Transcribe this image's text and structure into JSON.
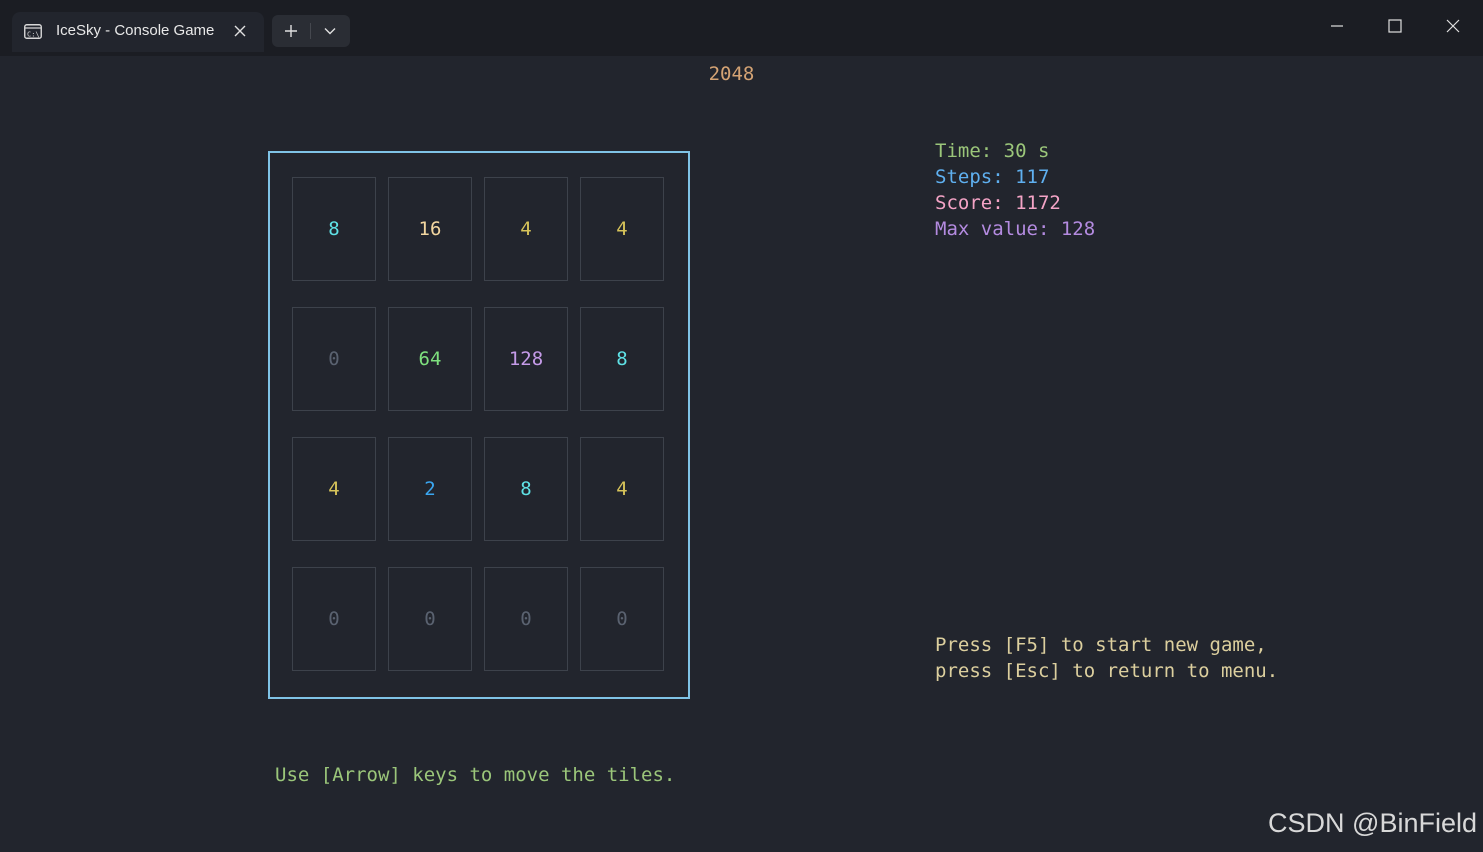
{
  "window": {
    "tab_title": "IceSky - Console Game",
    "icons": {
      "tab": "terminal-icon",
      "close": "close-icon",
      "new_tab": "plus-icon",
      "dropdown": "chevron-down-icon",
      "minimize": "minimize-icon",
      "maximize": "maximize-icon",
      "close_window": "close-icon"
    }
  },
  "game": {
    "title": "2048",
    "grid": [
      [
        "8",
        "16",
        "4",
        "4"
      ],
      [
        "0",
        "64",
        "128",
        "8"
      ],
      [
        "4",
        "2",
        "8",
        "4"
      ],
      [
        "0",
        "0",
        "0",
        "0"
      ]
    ],
    "tile_colors": {
      "0": "#5a6270",
      "2": "#3aa6f0",
      "4": "#d7c45a",
      "8": "#5fe2e6",
      "16": "#f2d6a0",
      "64": "#7ee07e",
      "128": "#c59be8"
    },
    "board_border_color": "#7fc3e6"
  },
  "stats": {
    "time": "Time: 30 s",
    "steps": "Steps: 117",
    "score": "Score: 1172",
    "max_value": "Max value: 128",
    "colors": {
      "time": "#9bc67a",
      "steps": "#5fb0f0",
      "score": "#f4a4c6",
      "max_value": "#b48be0"
    }
  },
  "help": {
    "line1": "Press [F5] to start new game,",
    "line2": "press [Esc] to return to menu.",
    "moves": "Use [Arrow] keys to move the tiles."
  },
  "watermark": "CSDN @BinField"
}
